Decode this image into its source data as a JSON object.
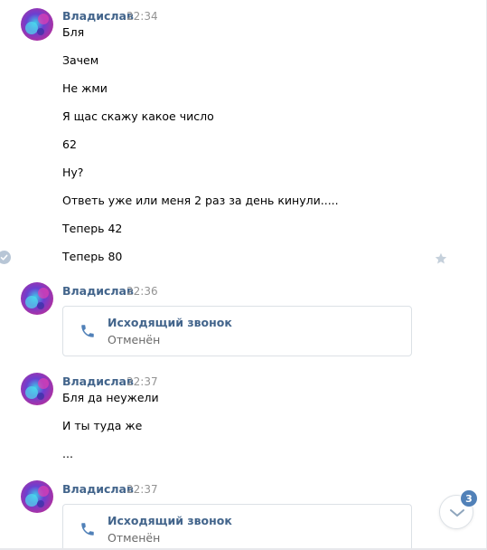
{
  "colors": {
    "author_name": "#42648b",
    "timestamp": "#939393",
    "message_text": "#000000",
    "call_status": "#6a6a6a",
    "badge_bg": "#5181b8",
    "card_border": "#dce1e6"
  },
  "messages": [
    {
      "author": "Владислав",
      "time": "22:34",
      "lines": [
        "Бля",
        "Зачем",
        "Не жми",
        "Я щас скажу какое число",
        "62",
        "Ну?",
        "Ответь уже или меня 2 раз за день кинули.....",
        "Теперь 42",
        "Теперь 80"
      ]
    },
    {
      "author": "Владислав",
      "time": "22:36",
      "call": {
        "title": "Исходящий звонок",
        "status": "Отменён",
        "icon": "phone-icon"
      }
    },
    {
      "author": "Владислав",
      "time": "22:37",
      "lines": [
        "Бля да неужели",
        "И ты туда же",
        "..."
      ]
    },
    {
      "author": "Владислав",
      "time": "22:37",
      "call": {
        "title": "Исходящий звонок",
        "status": "Отменён",
        "icon": "phone-icon"
      }
    }
  ],
  "icons": {
    "read_status": "check-circle-icon",
    "favorite": "star-icon",
    "scroll_down": "chevron-down-icon"
  },
  "unread_badge": "3"
}
